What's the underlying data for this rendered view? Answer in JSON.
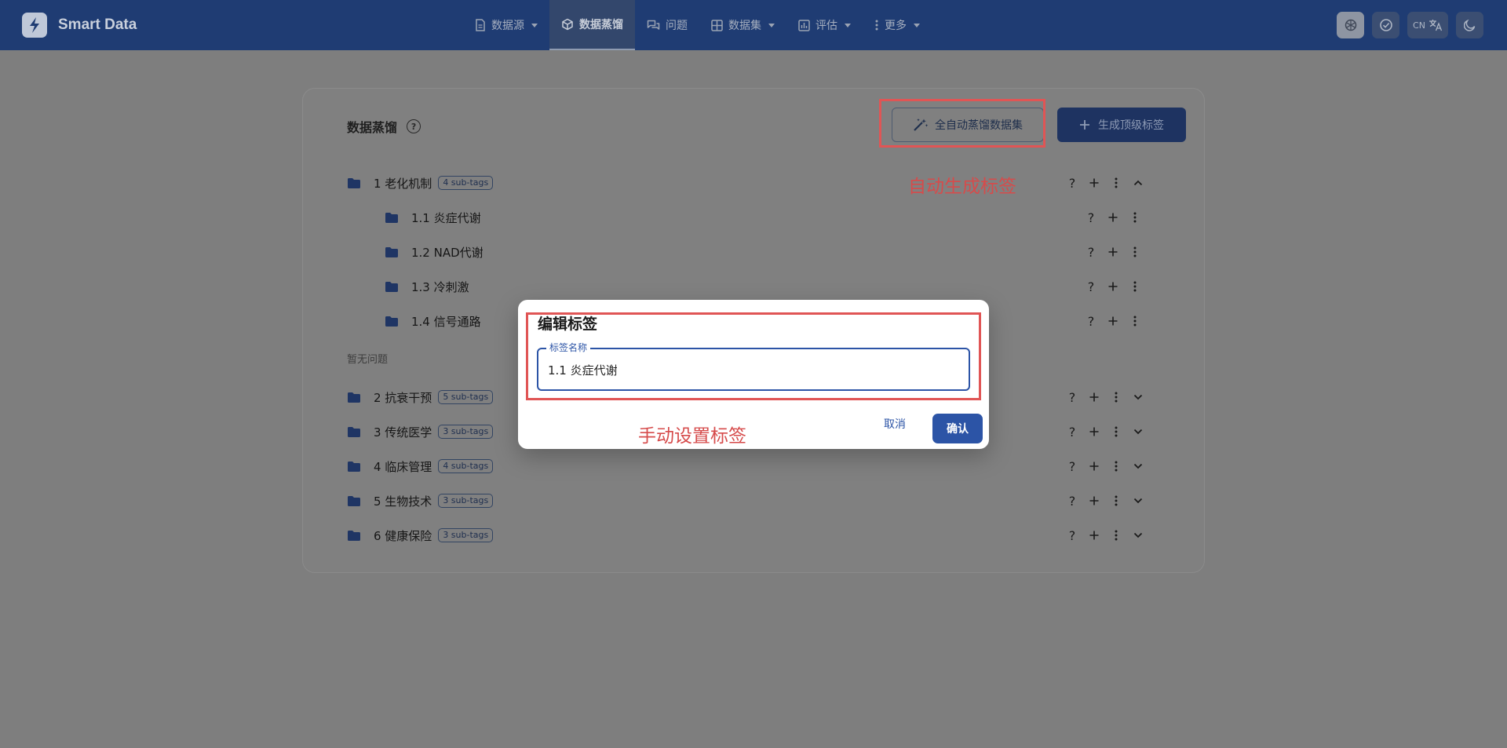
{
  "brand": {
    "name": "Smart Data"
  },
  "nav": {
    "items": [
      {
        "label": "数据源",
        "icon": "document-icon",
        "dropdown": true,
        "active": false
      },
      {
        "label": "数据蒸馏",
        "icon": "cube-icon",
        "dropdown": false,
        "active": true
      },
      {
        "label": "问题",
        "icon": "chat-icon",
        "dropdown": false,
        "active": false
      },
      {
        "label": "数据集",
        "icon": "grid-icon",
        "dropdown": true,
        "active": false
      },
      {
        "label": "评估",
        "icon": "chart-icon",
        "dropdown": true,
        "active": false
      },
      {
        "label": "更多",
        "icon": "dots-vertical-icon",
        "dropdown": true,
        "active": false
      }
    ]
  },
  "tools": {
    "lang_label": "CN"
  },
  "main": {
    "title": "数据蒸馏",
    "auto_button": "全自动蒸馏数据集",
    "generate_button": "生成顶级标签",
    "no_questions": "暂无问题",
    "tags": [
      {
        "label": "1 老化机制",
        "badge": "4 sub-tags",
        "expanded": true,
        "children": [
          "1.1 炎症代谢",
          "1.2 NAD代谢",
          "1.3 冷刺激",
          "1.4 信号通路"
        ]
      },
      {
        "label": "2 抗衰干预",
        "badge": "5 sub-tags",
        "expanded": false
      },
      {
        "label": "3 传统医学",
        "badge": "3 sub-tags",
        "expanded": false
      },
      {
        "label": "4 临床管理",
        "badge": "4 sub-tags",
        "expanded": false
      },
      {
        "label": "5 生物技术",
        "badge": "3 sub-tags",
        "expanded": false
      },
      {
        "label": "6 健康保险",
        "badge": "3 sub-tags",
        "expanded": false
      }
    ]
  },
  "annotations": {
    "auto_label": "自动生成标签",
    "manual_label": "手动设置标签",
    "color": "#e05555"
  },
  "modal": {
    "title": "编辑标签",
    "field_label": "标签名称",
    "field_value": "1.1 炎症代谢",
    "cancel": "取消",
    "confirm": "确认"
  },
  "colors": {
    "navbar": "#1f3c73",
    "accent": "#2c54a6",
    "overlay": "#7e7e7e"
  }
}
